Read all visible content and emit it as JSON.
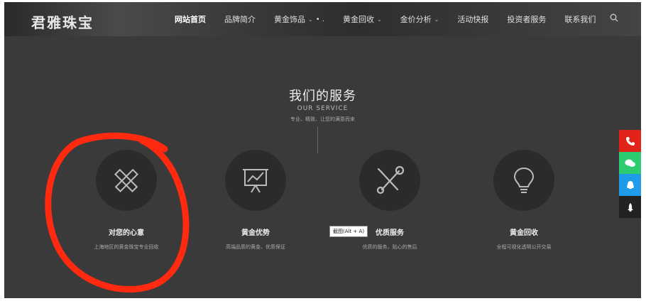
{
  "header": {
    "logo": "君雅珠宝",
    "nav": [
      {
        "label": "网站首页",
        "active": true,
        "dropdown": false
      },
      {
        "label": "品牌简介",
        "active": false,
        "dropdown": false
      },
      {
        "label": "黄金饰品",
        "active": false,
        "dropdown": true
      },
      {
        "label": "黄金回收",
        "active": false,
        "dropdown": true
      },
      {
        "label": "金价分析",
        "active": false,
        "dropdown": true
      },
      {
        "label": "活动快报",
        "active": false,
        "dropdown": false
      },
      {
        "label": "投资者服务",
        "active": false,
        "dropdown": false
      },
      {
        "label": "联系我们",
        "active": false,
        "dropdown": false
      }
    ],
    "search_icon": "search-icon"
  },
  "section": {
    "title": "我们的服务",
    "subtitle": "OUR SERVICE",
    "description": "专业、精致、让您的满意而来"
  },
  "services": [
    {
      "title": "对您的心意",
      "description": "上海地区的黄金珠宝专业回收",
      "icon": "pencil-ruler-icon"
    },
    {
      "title": "黄金优势",
      "description": "高端品质的黄金、优质保证",
      "icon": "presentation-chart-icon"
    },
    {
      "title": "优质服务",
      "description": "优质的服务，贴心的售后",
      "icon": "tools-icon"
    },
    {
      "title": "黄金回收",
      "description": "全程可视化透明公开交易",
      "icon": "lightbulb-icon"
    }
  ],
  "tooltip": "截图(Alt + A)",
  "side_toolbar": [
    {
      "icon": "phone-icon",
      "color": "#e2231a"
    },
    {
      "icon": "wechat-icon",
      "color": "#2ecc71"
    },
    {
      "icon": "qq-icon",
      "color": "#1e9be9"
    },
    {
      "icon": "rocket-top-icon",
      "color": "#222222"
    }
  ],
  "annotation": {
    "color": "#ff2a10"
  }
}
